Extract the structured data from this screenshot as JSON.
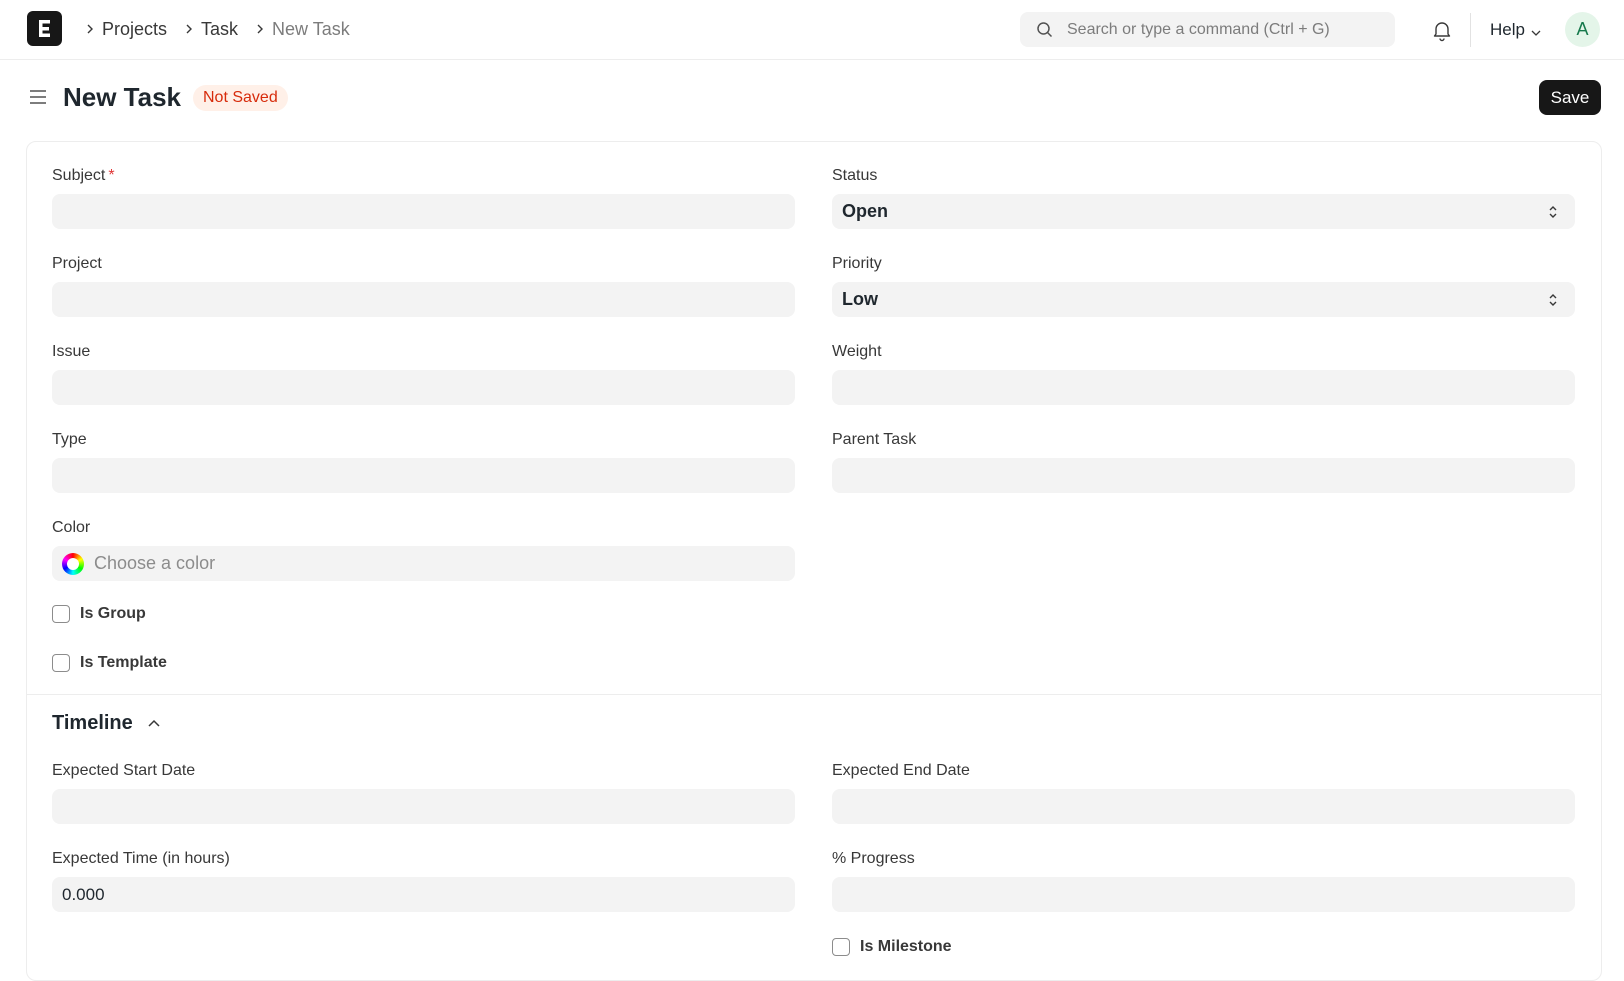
{
  "navbar": {
    "logo_letter": "E",
    "breadcrumbs": [
      "Projects",
      "Task",
      "New Task"
    ],
    "search_placeholder": "Search or type a command (Ctrl + G)",
    "help_label": "Help",
    "avatar_initial": "A"
  },
  "page": {
    "title": "New Task",
    "status_badge": "Not Saved",
    "save_label": "Save"
  },
  "form": {
    "subject": {
      "label": "Subject",
      "required_mark": "*",
      "value": ""
    },
    "status": {
      "label": "Status",
      "value": "Open"
    },
    "project": {
      "label": "Project",
      "value": ""
    },
    "priority": {
      "label": "Priority",
      "value": "Low"
    },
    "issue": {
      "label": "Issue",
      "value": ""
    },
    "weight": {
      "label": "Weight",
      "value": ""
    },
    "type": {
      "label": "Type",
      "value": ""
    },
    "parent_task": {
      "label": "Parent Task",
      "value": ""
    },
    "color": {
      "label": "Color",
      "placeholder": "Choose a color"
    },
    "is_group": {
      "label": "Is Group",
      "checked": false
    },
    "is_template": {
      "label": "Is Template",
      "checked": false
    }
  },
  "timeline": {
    "title": "Timeline",
    "expected_start_date": {
      "label": "Expected Start Date",
      "value": ""
    },
    "expected_end_date": {
      "label": "Expected End Date",
      "value": ""
    },
    "expected_time": {
      "label": "Expected Time (in hours)",
      "value": "0.000"
    },
    "progress": {
      "label": "% Progress",
      "value": ""
    },
    "is_milestone": {
      "label": "Is Milestone",
      "checked": false
    }
  },
  "colors": {
    "badge_bg": "#fff0e8",
    "badge_text": "#d72b0b",
    "primary_button": "#171717",
    "field_bg": "#f3f3f3",
    "avatar_bg": "#e4f5e9",
    "avatar_text": "#16794c"
  },
  "icons": [
    "app-logo-icon",
    "chevron-right-icon",
    "search-icon",
    "bell-icon",
    "chevron-down-icon",
    "hamburger-icon",
    "select-updown-icon",
    "color-wheel-icon",
    "chevron-up-icon"
  ]
}
